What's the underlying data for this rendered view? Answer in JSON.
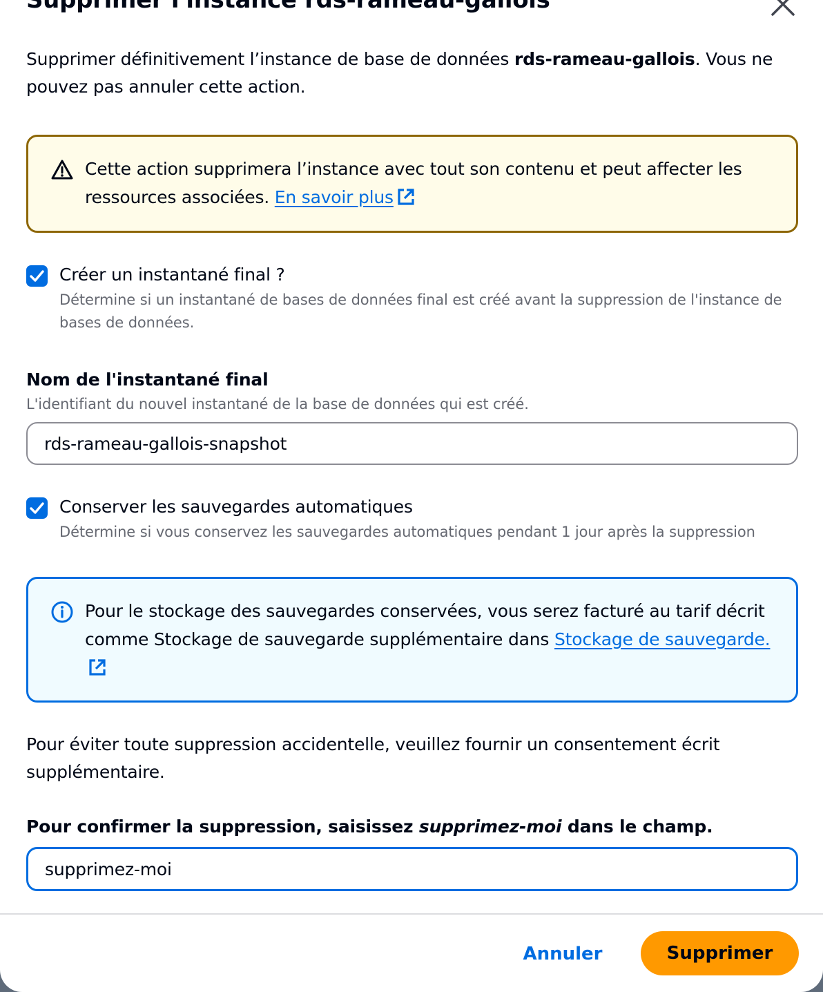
{
  "modal": {
    "title": "Supprimer l'instance rds-rameau-gallois",
    "intro_prefix": "Supprimer définitivement l’instance de base de données ",
    "intro_instance": "rds-rameau-gallois",
    "intro_suffix": ". Vous ne pouvez pas annuler cette action."
  },
  "warning": {
    "text": "Cette action supprimera l’instance avec tout son contenu et peut affecter les ressources associées. ",
    "link": "En savoir plus"
  },
  "final_snapshot": {
    "checked": true,
    "label": "Créer un instantané final ?",
    "description": "Détermine si un instantané de bases de données final est créé avant la suppression de l'instance de bases de données."
  },
  "snapshot_name": {
    "label": "Nom de l'instantané final",
    "description": "L'identifiant du nouvel instantané de la base de données qui est créé.",
    "value": "rds-rameau-gallois-snapshot"
  },
  "retain_backups": {
    "checked": true,
    "label": "Conserver les sauvegardes automatiques",
    "description": "Détermine si vous conservez les sauvegardes automatiques pendant 1 jour après la suppression"
  },
  "info": {
    "text": "Pour le stockage des sauvegardes conservées, vous serez facturé au tarif décrit comme Stockage de sauvegarde supplémentaire dans ",
    "link": "Stockage de sauvegarde."
  },
  "consent": {
    "text": "Pour éviter toute suppression accidentelle, veuillez fournir un consentement écrit supplémentaire.",
    "label_prefix": "Pour confirmer la suppression, saisissez ",
    "label_keyword": "supprimez-moi",
    "label_suffix": " dans le champ.",
    "value": "supprimez-moi"
  },
  "footer": {
    "cancel_label": "Annuler",
    "delete_label": "Supprimer"
  },
  "colors": {
    "accent": "#006ce0",
    "primary_button": "#ff9900",
    "warning_border": "#8d6605",
    "warning_bg": "#fffce9",
    "info_bg": "#f0fbff"
  }
}
